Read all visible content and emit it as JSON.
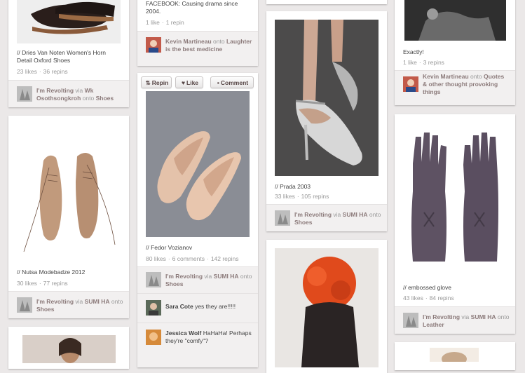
{
  "pins": {
    "p1": {
      "description": "// Dries Van Noten Women's Horn Detail Oxford Shoes",
      "likes": "23 likes",
      "repins": "36 repins",
      "attr_user": "I'm Revolting",
      "attr_via": "via",
      "attr_source": "Wk Osothsongkroh",
      "attr_onto": "onto",
      "attr_board": "Shoes"
    },
    "p2": {
      "description": "// Nutsa Modebadze 2012",
      "likes": "30 likes",
      "repins": "77 repins",
      "attr_user": "I'm Revolting",
      "attr_via": "via",
      "attr_source": "SUMI HA",
      "attr_onto": "onto",
      "attr_board": "Shoes"
    },
    "p3": {
      "description": "FACEBOOK: Causing drama since 2004.",
      "likes": "1 like",
      "repins": "1 repin",
      "attr_user": "Kevin Martineau",
      "attr_onto": "onto",
      "attr_board": "Laughter is the best medicine"
    },
    "p4": {
      "buttons": {
        "repin": "Repin",
        "like": "Like",
        "comment": "Comment"
      },
      "description": "// Fedor Vozianov",
      "likes": "80 likes",
      "comments": "6 comments",
      "repins": "142 repins",
      "attr_user": "I'm Revolting",
      "attr_via": "via",
      "attr_source": "SUMI HA",
      "attr_onto": "onto",
      "attr_board": "Shoes",
      "comment1_user": "Sara Cote",
      "comment1_text": "yes they are!!!!!",
      "comment2_user": "Jessica Wolf",
      "comment2_text": "HaHaHa! Perhaps they're \"comfy\"?"
    },
    "p5": {
      "description": "// Prada 2003",
      "likes": "33 likes",
      "repins": "105 repins",
      "attr_user": "I'm Revolting",
      "attr_via": "via",
      "attr_source": "SUMI HA",
      "attr_onto": "onto",
      "attr_board": "Shoes"
    },
    "p7": {
      "description": "Exactly!",
      "likes": "1 like",
      "repins": "3 repins",
      "attr_user": "Kevin Martineau",
      "attr_onto": "onto",
      "attr_board": "Quotes & other thought provoking things"
    },
    "p8": {
      "description": "// embossed glove",
      "likes": "43 likes",
      "repins": "84 repins",
      "attr_user": "I'm Revolting",
      "attr_via": "via",
      "attr_source": "SUMI HA",
      "attr_onto": "onto",
      "attr_board": "Leather"
    }
  },
  "colors": {
    "background": "#ebe8e8",
    "link": "#8c7b7b",
    "muted": "#999999"
  }
}
